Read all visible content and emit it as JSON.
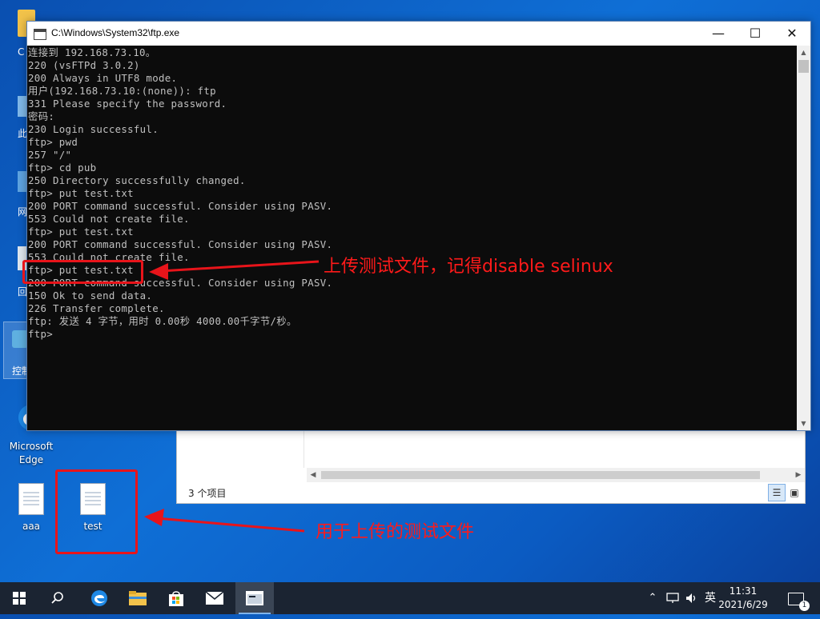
{
  "desktop": {
    "icons": [
      {
        "label": "Microsoft\nEdge",
        "icon": "edge-icon"
      },
      {
        "label": "aaa",
        "icon": "text-file-icon"
      },
      {
        "label": "test",
        "icon": "text-file-icon"
      }
    ],
    "partial_labels": [
      "C",
      "此",
      "网",
      "回",
      "控制"
    ]
  },
  "explorer": {
    "status": "3 个项目"
  },
  "console": {
    "title": "C:\\Windows\\System32\\ftp.exe",
    "lines": [
      "连接到 192.168.73.10。",
      "220 (vsFTPd 3.0.2)",
      "200 Always in UTF8 mode.",
      "用户(192.168.73.10:(none)): ftp",
      "331 Please specify the password.",
      "密码:",
      "230 Login successful.",
      "ftp> pwd",
      "257 \"/\"",
      "ftp> cd pub",
      "250 Directory successfully changed.",
      "ftp> put test.txt",
      "200 PORT command successful. Consider using PASV.",
      "553 Could not create file.",
      "ftp> put test.txt",
      "200 PORT command successful. Consider using PASV.",
      "553 Could not create file.",
      "ftp> put test.txt",
      "200 PORT command successful. Consider using PASV.",
      "150 Ok to send data.",
      "226 Transfer complete.",
      "ftp: 发送 4 字节，用时 0.00秒 4000.00千字节/秒。",
      "ftp>"
    ]
  },
  "annotations": {
    "upload_note": "上传测试文件，记得disable selinux",
    "file_note": "用于上传的测试文件",
    "color": "#e8141a"
  },
  "taskbar": {
    "items": [
      "start-icon",
      "search-icon",
      "edge-icon",
      "file-explorer-icon",
      "store-icon",
      "mail-icon",
      "console-icon"
    ],
    "ime": "英",
    "time": "11:31",
    "date": "2021/6/29",
    "notification_count": "1"
  }
}
